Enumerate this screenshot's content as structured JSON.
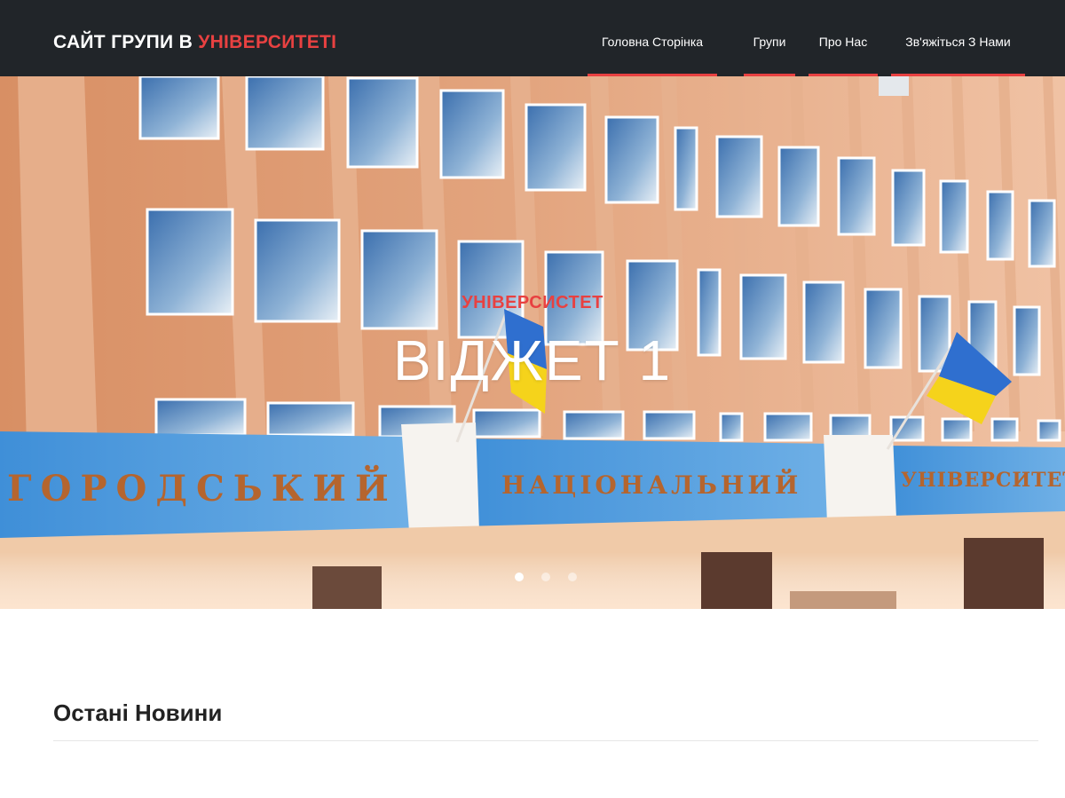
{
  "header": {
    "brand_prefix": "САЙТ ГРУПИ В",
    "brand_accent": "УНІВЕРСИТЕТІ",
    "accent_color": "#e84141",
    "background_color": "#212529",
    "nav": [
      {
        "label": "Головна Сторінка"
      },
      {
        "label": "Групи"
      },
      {
        "label": "Про Нас"
      },
      {
        "label": "Зв'яжіться З Нами"
      }
    ]
  },
  "hero": {
    "subtitle": "УНІВЕРСИСТЕТ",
    "title": "ВІДЖЕТ 1",
    "image_icon": "university-building-photo",
    "slides": 3,
    "active_slide": 1,
    "building_signs": [
      "ГОРОДСЬКИЙ",
      "НАЦІОНАЛЬНИЙ",
      "УНІВЕРСИТЕТ"
    ]
  },
  "news": {
    "heading": "Остані Новини"
  }
}
